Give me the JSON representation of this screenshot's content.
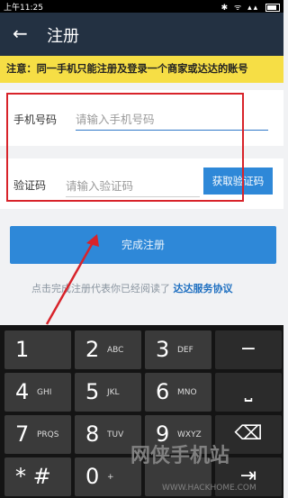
{
  "status_bar": {
    "time": "上午11:25",
    "icons": "✱ ᯤ ▴▴"
  },
  "app_bar": {
    "back_icon": "←",
    "title": "注册"
  },
  "notice": {
    "text": "注意：同一手机只能注册及登录一个商家或达达的账号"
  },
  "form": {
    "phone_label": "手机号码",
    "phone_placeholder": "请输入手机号码",
    "code_label": "验证码",
    "code_placeholder": "请输入验证码",
    "get_code_button": "获取验证码"
  },
  "finish_button": "完成注册",
  "agreement": {
    "prefix": "点击完成注册代表你已经阅读了",
    "link": "达达服务协议"
  },
  "keyboard": {
    "rows": [
      [
        {
          "num": "1",
          "letters": ""
        },
        {
          "num": "2",
          "letters": "ABC"
        },
        {
          "num": "3",
          "letters": "DEF"
        },
        {
          "sym": "−"
        }
      ],
      [
        {
          "num": "4",
          "letters": "GHI"
        },
        {
          "num": "5",
          "letters": "JKL"
        },
        {
          "num": "6",
          "letters": "MNO"
        },
        {
          "sym": "⎵"
        }
      ],
      [
        {
          "num": "7",
          "letters": "PRQS"
        },
        {
          "num": "8",
          "letters": "TUV"
        },
        {
          "num": "9",
          "letters": "WXYZ"
        },
        {
          "sym": "⌫"
        }
      ],
      [
        {
          "num": "* #",
          "letters": ""
        },
        {
          "num": "0",
          "letters": "+"
        },
        {
          "num": "",
          "letters": ""
        },
        {
          "sym": "⇥"
        }
      ]
    ]
  },
  "watermark": {
    "text": "网侠手机站",
    "url": "WWW.HACKHOME.COM"
  },
  "colors": {
    "app_bar": "#233142",
    "notice": "#f6de45",
    "accent": "#2e88d8",
    "annotation": "#d8232a"
  }
}
